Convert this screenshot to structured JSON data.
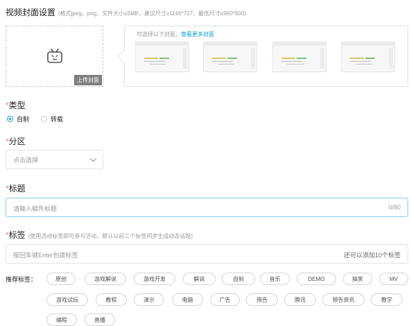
{
  "cover": {
    "title": "视频封面设置",
    "note": "(格式jpeg、png，文件大小≤5MB，建议尺寸≥1146*717，最低尺寸≥960*600)",
    "upload_label": "上传封面",
    "hint": "可选择以下封面，",
    "hint_link": "查看更多封面",
    "thumbnails": [
      "thumbnail-1",
      "thumbnail-2",
      "thumbnail-3",
      "thumbnail-4"
    ]
  },
  "type": {
    "required_mark": "*",
    "label": "类型",
    "options": [
      {
        "label": "自制",
        "selected": true
      },
      {
        "label": "转载",
        "selected": false
      }
    ]
  },
  "zone": {
    "required_mark": "*",
    "label": "分区",
    "placeholder": "点击选择"
  },
  "title_field": {
    "required_mark": "*",
    "label": "标题",
    "placeholder": "请输入稿件标题",
    "counter": "0/80"
  },
  "tags": {
    "required_mark": "*",
    "label": "标签",
    "note": "(使用活动标签即可参与活动，默认以前三个标签同步生成动态话题)",
    "placeholder": "按回车键Enter创建标签",
    "remaining": "还可以添加10个标签",
    "recommended_label": "推荐标签：",
    "recommended": [
      "原创",
      "游戏解说",
      "游戏开发",
      "解说",
      "自制",
      "音乐",
      "DEMO",
      "搞笑",
      "MV",
      "游戏试玩",
      "教程",
      "演示",
      "电脑",
      "广告",
      "预告",
      "腾讯",
      "预告资讯",
      "教学",
      "编程",
      "直播"
    ]
  },
  "colors": {
    "accent": "#00a1d6",
    "required": "#fb7299",
    "placeholder": "#999999"
  }
}
